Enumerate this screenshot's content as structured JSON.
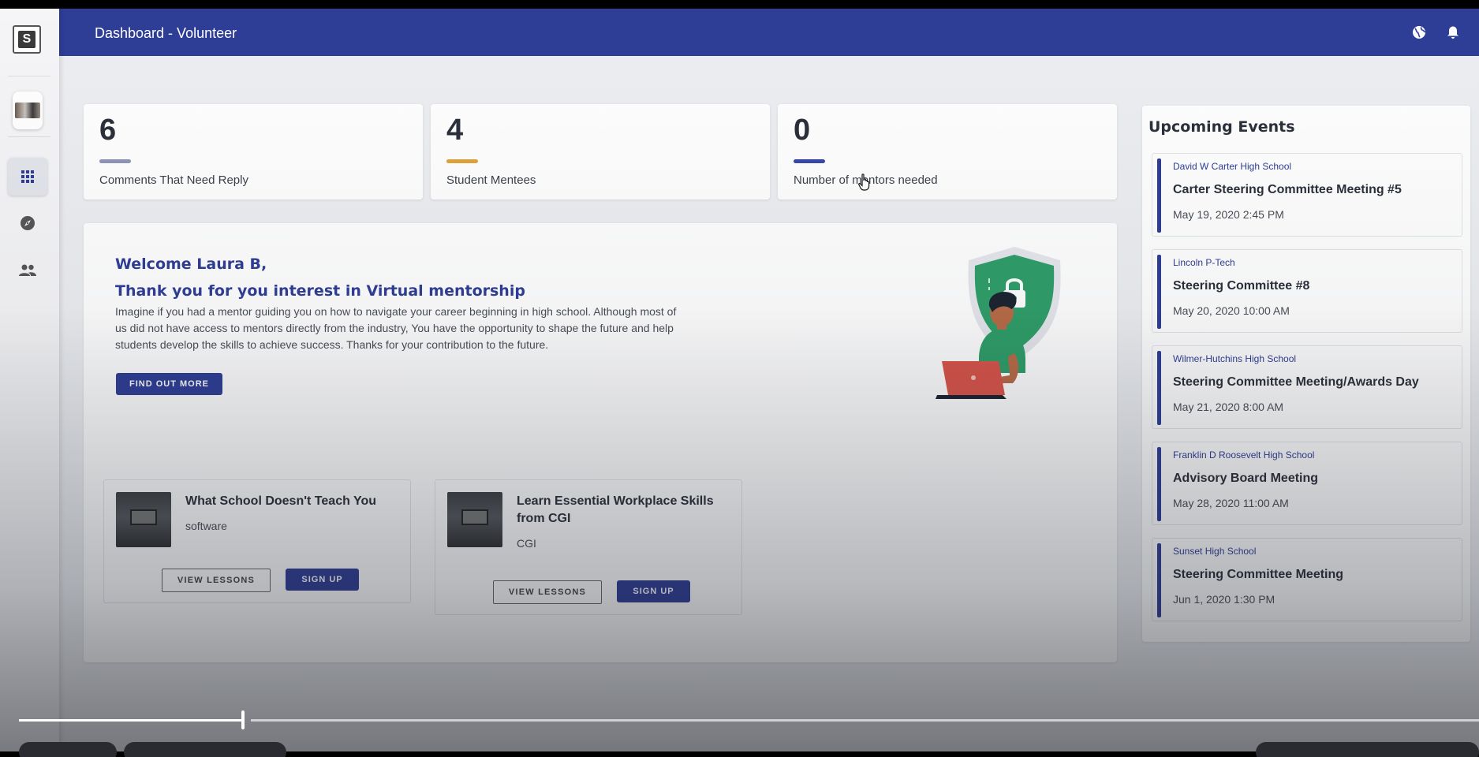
{
  "header": {
    "title": "Dashboard - Volunteer",
    "globe_icon": "globe-icon",
    "bell_icon": "bell-icon",
    "brand_color": "#2e3d96"
  },
  "sidebar": {
    "logo_letter": "S",
    "items": [
      {
        "name": "apps-grid",
        "icon": "apps-grid-icon",
        "active": true
      },
      {
        "name": "explore",
        "icon": "compass-icon",
        "active": false
      },
      {
        "name": "people",
        "icon": "people-icon",
        "active": false
      }
    ]
  },
  "stats": [
    {
      "value": "6",
      "label": "Comments That Need Reply",
      "color": "#8f96b8"
    },
    {
      "value": "4",
      "label": "Student Mentees",
      "color": "#e0a43a"
    },
    {
      "value": "0",
      "label": "Number of mentors needed",
      "color": "#3848a8"
    }
  ],
  "welcome": {
    "greeting": "Welcome Laura B,",
    "subtitle": "Thank you for you interest in Virtual mentorship",
    "body": "Imagine if you had a mentor guiding you on how to navigate your career beginning in high school. Although most of us did not have access to mentors directly from the industry, You have the opportunity to shape the future and help students develop the skills to achieve success. Thanks for your contribution to the future.",
    "cta": "FIND OUT MORE"
  },
  "courses": [
    {
      "title": "What School Doesn't Teach You",
      "subtitle": "software",
      "view_label": "VIEW LESSONS",
      "signup_label": "SIGN UP"
    },
    {
      "title": "Learn Essential Workplace Skills from CGI",
      "subtitle": "CGI",
      "view_label": "VIEW LESSONS",
      "signup_label": "SIGN UP"
    }
  ],
  "events": {
    "heading": "Upcoming Events",
    "items": [
      {
        "school": "David W Carter High School",
        "title": "Carter Steering Committee Meeting #5",
        "date": "May 19, 2020 2:45 PM"
      },
      {
        "school": "Lincoln P-Tech",
        "title": "Steering Committee #8",
        "date": "May 20, 2020 10:00 AM"
      },
      {
        "school": "Wilmer-Hutchins High School",
        "title": "Steering Committee Meeting/Awards Day",
        "date": "May 21, 2020 8:00 AM"
      },
      {
        "school": "Franklin D Roosevelt High School",
        "title": "Advisory Board Meeting",
        "date": "May 28, 2020 11:00 AM"
      },
      {
        "school": "Sunset High School",
        "title": "Steering Committee Meeting",
        "date": "Jun 1, 2020 1:30 PM"
      }
    ]
  },
  "video": {
    "progress": 0.16
  }
}
